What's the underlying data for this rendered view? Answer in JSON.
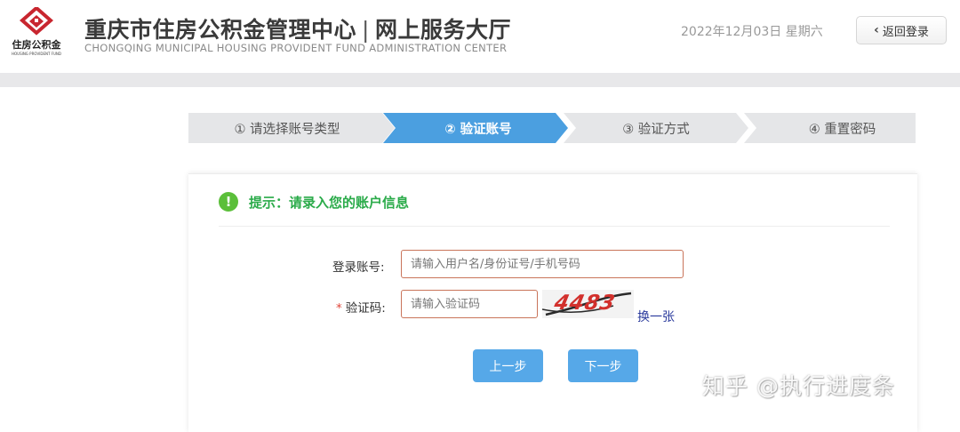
{
  "header": {
    "logo_text": "住房公积金",
    "logo_sub": "HOUSING PROVIDENT FUND",
    "title": "重庆市住房公积金管理中心",
    "title_sep": "|",
    "title_right": "网上服务大厅",
    "subtitle": "CHONGQING MUNICIPAL HOUSING PROVIDENT FUND ADMINISTRATION CENTER",
    "date": "2022年12月03日 星期六",
    "back_label": "返回登录",
    "brand_color": "#c8262f"
  },
  "steps": [
    {
      "label": "① 请选择账号类型",
      "active": false
    },
    {
      "label": "② 验证账号",
      "active": true
    },
    {
      "label": "③ 验证方式",
      "active": false
    },
    {
      "label": "④ 重置密码",
      "active": false
    }
  ],
  "form": {
    "tip": "提示：请录入您的账户信息",
    "account_label": "登录账号:",
    "account_placeholder": "请输入用户名/身份证号/手机号码",
    "captcha_required": "*",
    "captcha_label": "验证码:",
    "captcha_placeholder": "请输入验证码",
    "captcha_text": "4483",
    "refresh_label": "换一张",
    "prev_label": "上一步",
    "next_label": "下一步"
  },
  "watermark": "知乎 @执行进度条",
  "colors": {
    "active_step": "#4b9fe0",
    "button": "#56a8e8",
    "tip_green": "#2bab4a"
  }
}
